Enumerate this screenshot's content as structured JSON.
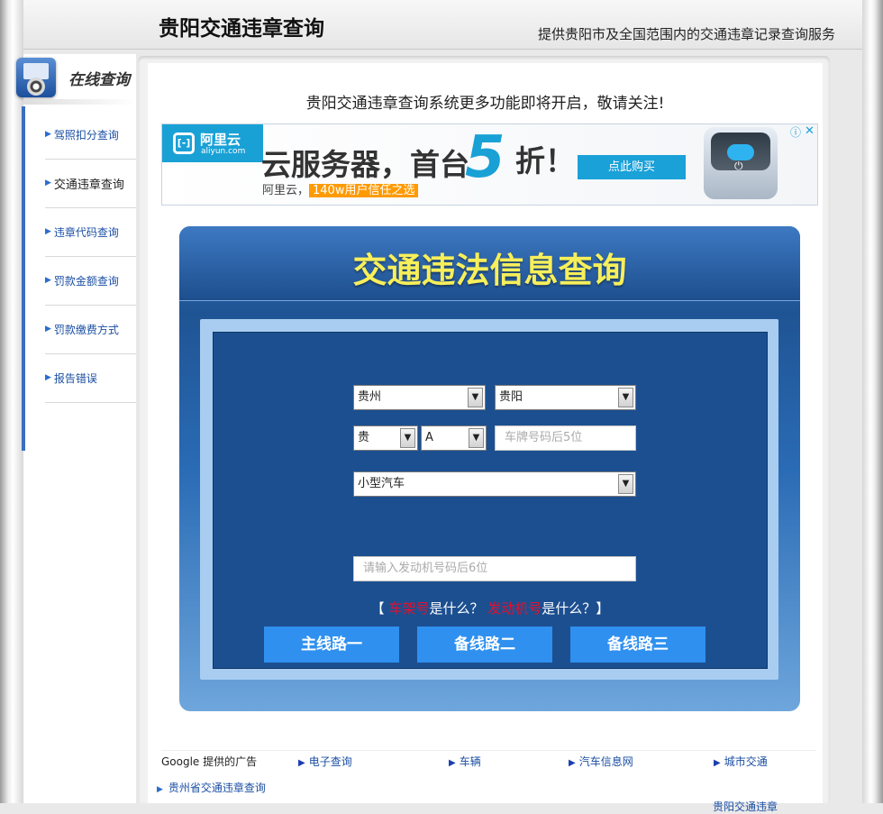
{
  "header": {
    "title": "贵阳交通违章查询",
    "tagline": "提供贵阳市及全国范围内的交通违章记录查询服务"
  },
  "sidebar": {
    "title": "在线查询",
    "items": [
      {
        "label": "驾照扣分查询"
      },
      {
        "label": "交通违章查询"
      },
      {
        "label": "违章代码查询"
      },
      {
        "label": "罚款金额查询"
      },
      {
        "label": "罚款缴费方式"
      },
      {
        "label": "报告错误"
      }
    ]
  },
  "main": {
    "notice": "贵阳交通违章查询系统更多功能即将开启，敬请关注!"
  },
  "ad": {
    "brand": "阿里云",
    "brand_sub": "aliyun.com",
    "headline": "云服务器，首台",
    "big_number": "5",
    "suffix": "折！",
    "sub_prefix": "阿里云，",
    "sub_highlight": "140w用户信任之选",
    "button": "点此购买",
    "info_icon": "ⓘ",
    "close_icon": "✕",
    "colors": {
      "brand": "#19a1d6",
      "highlight": "#ff9a00"
    }
  },
  "query": {
    "title": "交通违法信息查询",
    "province": "贵州",
    "city": "贵阳",
    "plate_prefix": "贵",
    "plate_letter": "A",
    "plate_placeholder": "车牌号码后5位",
    "vehicle_type": "小型汽车",
    "engine_placeholder": "请输入发动机号码后6位",
    "help": {
      "open": "【",
      "link1": "车架号",
      "q1": "是什么？",
      "link2": "发动机号",
      "q2": "是什么？】"
    },
    "buttons": [
      "主线路一",
      "备线路二",
      "备线路三"
    ],
    "colors": {
      "title": "#f7ef5a",
      "button": "#2f90ef",
      "help_link": "#e4102c"
    }
  },
  "links": {
    "google_label": "Google 提供的广告",
    "items": [
      "电子查询",
      "车辆",
      "汽车信息网",
      "城市交通"
    ],
    "bottom_left": "贵州省交通违章查询",
    "bottom_right": "贵阳交通违章"
  }
}
